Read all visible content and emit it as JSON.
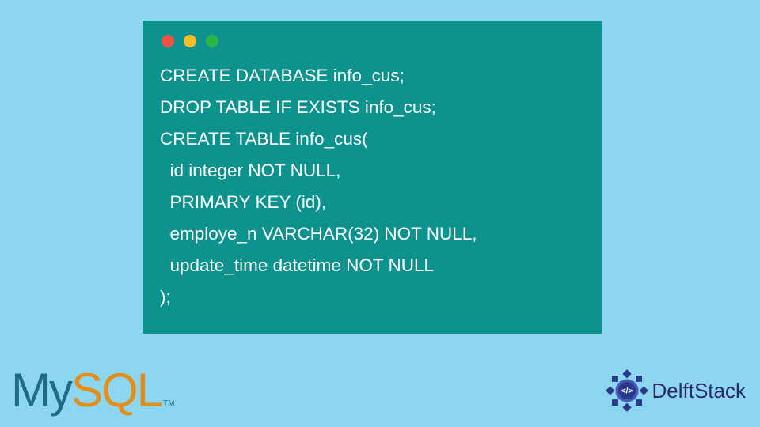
{
  "code": {
    "lines": [
      "CREATE DATABASE info_cus;",
      "DROP TABLE IF EXISTS info_cus;",
      "CREATE TABLE info_cus(",
      "  id integer NOT NULL,",
      "  PRIMARY KEY (id),",
      "  employe_n VARCHAR(32) NOT NULL,",
      "  update_time datetime NOT NULL",
      ");"
    ]
  },
  "mysql_logo": {
    "my": "My",
    "sql": "SQL",
    "tm": "TM"
  },
  "delft_logo": {
    "text": "DelftStack",
    "badge_code": "</>"
  },
  "colors": {
    "bg": "#8dd6f0",
    "window": "#0e928d",
    "code_text": "#ffffff",
    "mysql_my": "#1e6c87",
    "mysql_sql": "#e48e1a",
    "delft": "#2a2a6b"
  }
}
